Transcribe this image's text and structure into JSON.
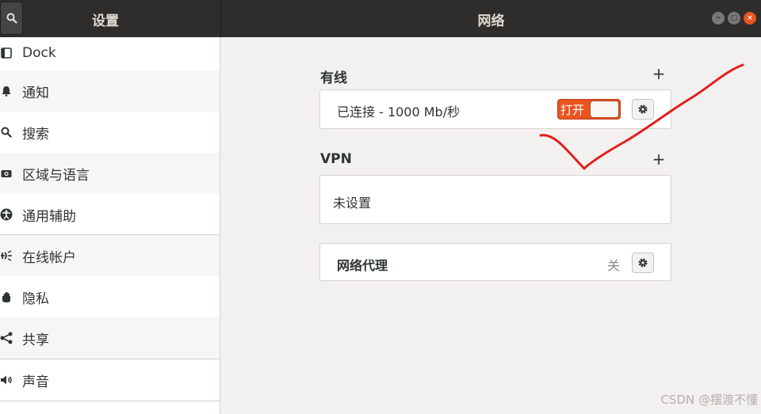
{
  "header": {
    "left_title": "设置",
    "main_title": "网络"
  },
  "sidebar": {
    "items": [
      {
        "label": "Dock",
        "icon": "dock-icon"
      },
      {
        "label": "通知",
        "icon": "bell-icon"
      },
      {
        "label": "搜索",
        "icon": "search-icon"
      },
      {
        "label": "区域与语言",
        "icon": "camera-icon"
      },
      {
        "label": "通用辅助",
        "icon": "accessibility-icon"
      },
      {
        "label": "在线帐户",
        "icon": "online-accounts-icon"
      },
      {
        "label": "隐私",
        "icon": "hand-icon"
      },
      {
        "label": "共享",
        "icon": "share-icon"
      },
      {
        "label": "声音",
        "icon": "speaker-icon"
      }
    ]
  },
  "wired": {
    "title": "有线",
    "add_label": "+",
    "connection_text": "已连接 - 1000 Mb/秒",
    "toggle_label": "打开",
    "toggle_on": true
  },
  "vpn": {
    "title": "VPN",
    "add_label": "+",
    "empty_text": "未设置"
  },
  "proxy": {
    "title": "网络代理",
    "status": "关"
  },
  "watermark": "CSDN @摆渡不懂",
  "colors": {
    "accent": "#e95420",
    "header_bg": "#2e2d2c",
    "annotation": "#e0201c"
  }
}
